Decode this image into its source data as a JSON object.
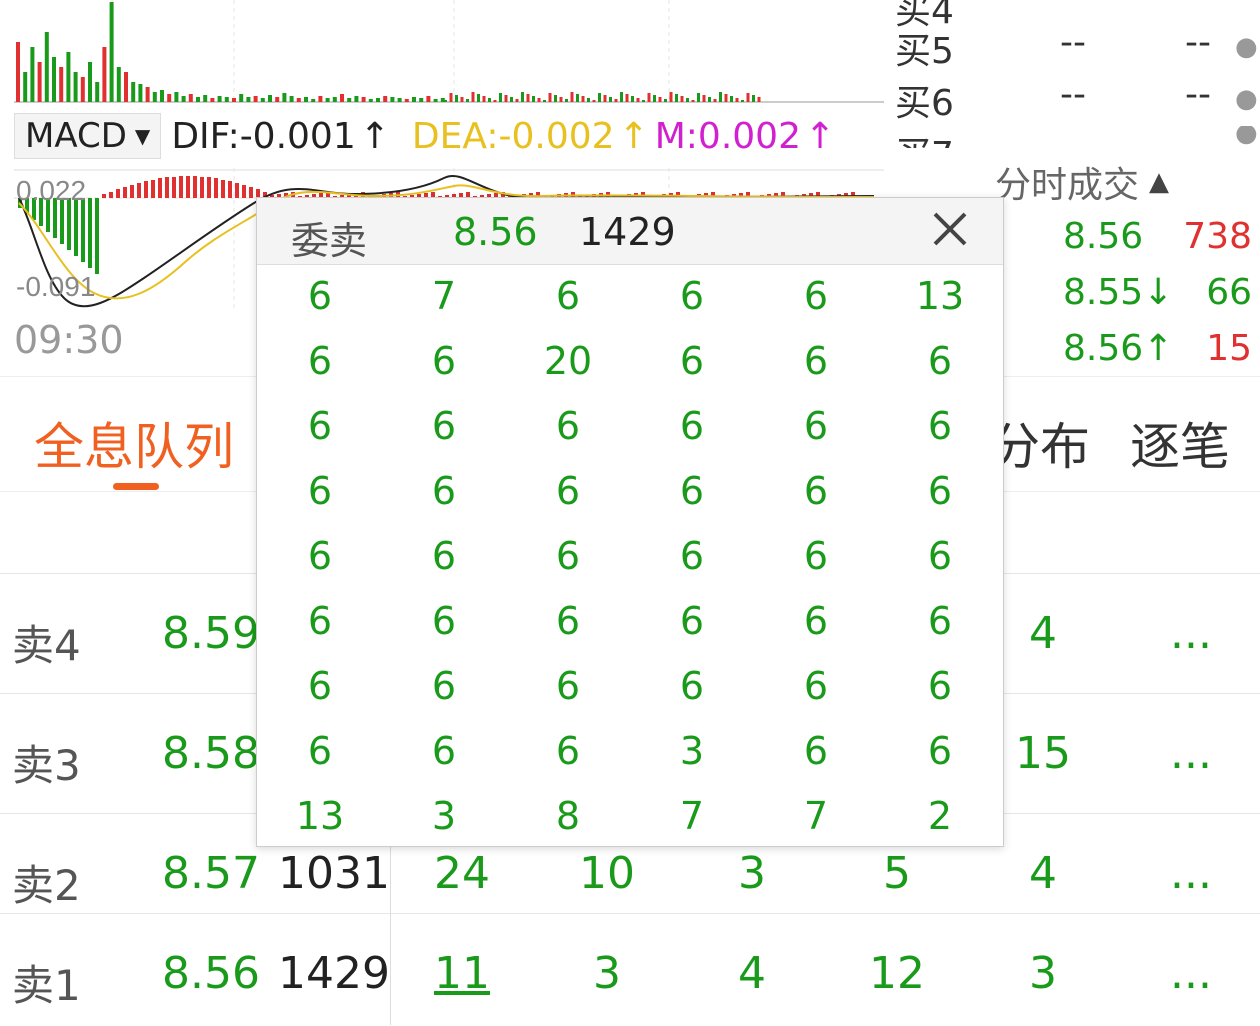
{
  "macd": {
    "selector_label": "MACD",
    "dif": "DIF:-0.001",
    "dea": "DEA:-0.002",
    "m": "M:0.002",
    "up_arrow": "↑",
    "axis_top": "0.022",
    "axis_bottom": "-0.091",
    "time_start": "09:30",
    "colors": {
      "dif": "#222222",
      "dea": "#e8c020",
      "m": "#d020d0",
      "up": "#e03030",
      "down": "#1a9a1a"
    }
  },
  "depth": [
    {
      "label": "买5",
      "v1": "--",
      "v2": "--"
    },
    {
      "label": "买6",
      "v1": "--",
      "v2": "--"
    }
  ],
  "trades": {
    "header": "分时成交",
    "rows": [
      {
        "price": "8.56",
        "qty": "738",
        "color": "red"
      },
      {
        "price": "8.55↓",
        "qty": "66",
        "color": "green"
      },
      {
        "price": "8.56↑",
        "qty": "15",
        "color": "red"
      }
    ]
  },
  "tabs": {
    "queue": "全息队列",
    "dist": "分布",
    "tick": "逐笔"
  },
  "queue": [
    {
      "label": "卖4",
      "price": "8.59",
      "vol": "",
      "cells": [
        "",
        "",
        "",
        "",
        "4"
      ],
      "more": "..."
    },
    {
      "label": "卖3",
      "price": "8.58",
      "vol": "",
      "cells": [
        "",
        "",
        "",
        "",
        "15"
      ],
      "more": "..."
    },
    {
      "label": "卖2",
      "price": "8.57",
      "vol": "1031",
      "cells": [
        "24",
        "10",
        "3",
        "5",
        "4"
      ],
      "more": "..."
    },
    {
      "label": "卖1",
      "price": "8.56",
      "vol": "1429",
      "cells": [
        "11",
        "3",
        "4",
        "12",
        "3"
      ],
      "more": "..."
    }
  ],
  "popup": {
    "title": "委卖",
    "price": "8.56",
    "volume": "1429",
    "grid": [
      [
        "6",
        "7",
        "6",
        "6",
        "6",
        "13"
      ],
      [
        "6",
        "6",
        "20",
        "6",
        "6",
        "6"
      ],
      [
        "6",
        "6",
        "6",
        "6",
        "6",
        "6"
      ],
      [
        "6",
        "6",
        "6",
        "6",
        "6",
        "6"
      ],
      [
        "6",
        "6",
        "6",
        "6",
        "6",
        "6"
      ],
      [
        "6",
        "6",
        "6",
        "6",
        "6",
        "6"
      ],
      [
        "6",
        "6",
        "6",
        "6",
        "6",
        "6"
      ],
      [
        "6",
        "6",
        "6",
        "3",
        "6",
        "6"
      ],
      [
        "13",
        "3",
        "8",
        "7",
        "7",
        "2"
      ]
    ]
  }
}
